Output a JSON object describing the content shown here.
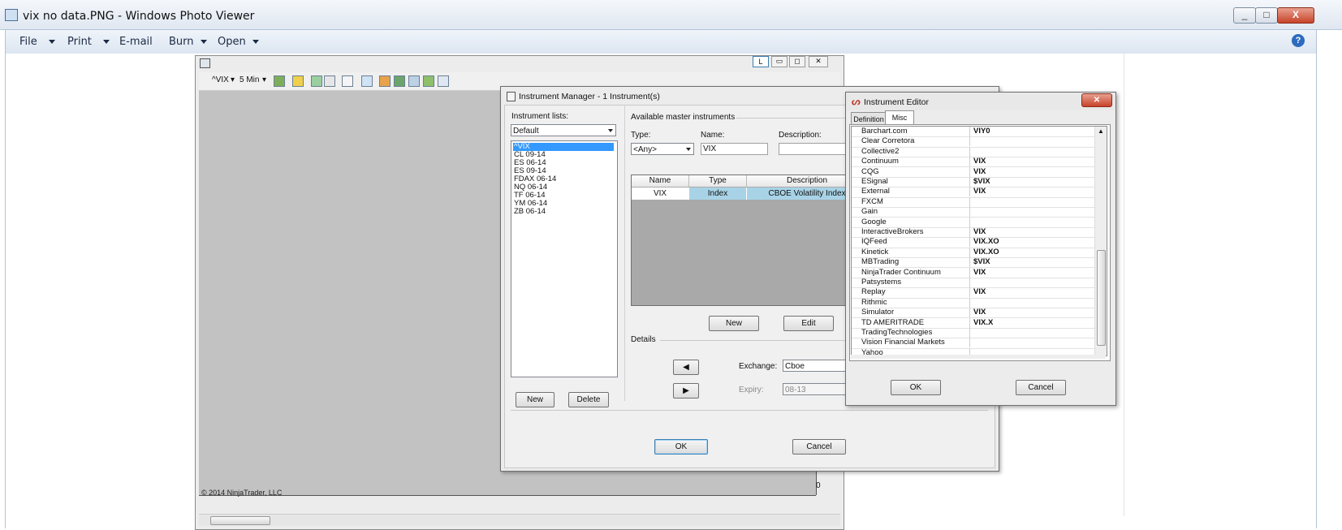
{
  "photo_viewer": {
    "title": "vix no data.PNG - Windows Photo Viewer",
    "menu": [
      "File",
      "Print",
      "E-mail",
      "Burn",
      "Open"
    ],
    "window_buttons": [
      "_",
      "□",
      "X"
    ]
  },
  "chart": {
    "instrument": "^VIX",
    "interval": "5 Min",
    "copyright": "© 2014 NinjaTrader, LLC",
    "axis_zero": "0",
    "window_badge": "L"
  },
  "instrument_manager": {
    "title": "Instrument Manager - 1 Instrument(s)",
    "lists_label": "Instrument lists:",
    "list_selected": "Default",
    "instruments": [
      "^VIX",
      "CL 09-14",
      "ES 06-14",
      "ES 09-14",
      "FDAX 06-14",
      "NQ 06-14",
      "TF 06-14",
      "YM 06-14",
      "ZB 06-14"
    ],
    "new_label": "New",
    "delete_label": "Delete",
    "available_label": "Available master instruments",
    "type_label": "Type:",
    "type_value": "<Any>",
    "name_label": "Name:",
    "name_value": "VIX",
    "description_label": "Description:",
    "grid_headers": [
      "Name",
      "Type",
      "Description"
    ],
    "grid_row": [
      "VIX",
      "Index",
      "CBOE Volatility Index"
    ],
    "grid_new": "New",
    "grid_edit": "Edit",
    "details_label": "Details",
    "exchange_label": "Exchange:",
    "exchange_value": "Cboe",
    "expiry_label": "Expiry:",
    "expiry_value": "08-13",
    "ok_label": "OK",
    "cancel_label": "Cancel"
  },
  "instrument_editor": {
    "title": "Instrument Editor",
    "tabs": [
      "Definition",
      "Misc"
    ],
    "providers": [
      {
        "name": "Barchart.com",
        "symbol": "VIY0"
      },
      {
        "name": "Clear Corretora",
        "symbol": ""
      },
      {
        "name": "Collective2",
        "symbol": ""
      },
      {
        "name": "Continuum",
        "symbol": "VIX"
      },
      {
        "name": "CQG",
        "symbol": "VIX"
      },
      {
        "name": "ESignal",
        "symbol": "$VIX"
      },
      {
        "name": "External",
        "symbol": "VIX"
      },
      {
        "name": "FXCM",
        "symbol": ""
      },
      {
        "name": "Gain",
        "symbol": ""
      },
      {
        "name": "Google",
        "symbol": ""
      },
      {
        "name": "InteractiveBrokers",
        "symbol": "VIX"
      },
      {
        "name": "IQFeed",
        "symbol": "VIX.XO"
      },
      {
        "name": "Kinetick",
        "symbol": "VIX.XO"
      },
      {
        "name": "MBTrading",
        "symbol": "$VIX"
      },
      {
        "name": "NinjaTrader Continuum",
        "symbol": "VIX"
      },
      {
        "name": "Patsystems",
        "symbol": ""
      },
      {
        "name": "Replay",
        "symbol": "VIX"
      },
      {
        "name": "Rithmic",
        "symbol": ""
      },
      {
        "name": "Simulator",
        "symbol": "VIX"
      },
      {
        "name": "TD AMERITRADE",
        "symbol": "VIX.X"
      },
      {
        "name": "TradingTechnologies",
        "symbol": ""
      },
      {
        "name": "Vision Financial Markets",
        "symbol": ""
      },
      {
        "name": "Yahoo",
        "symbol": ""
      }
    ],
    "ok_label": "OK",
    "cancel_label": "Cancel"
  }
}
